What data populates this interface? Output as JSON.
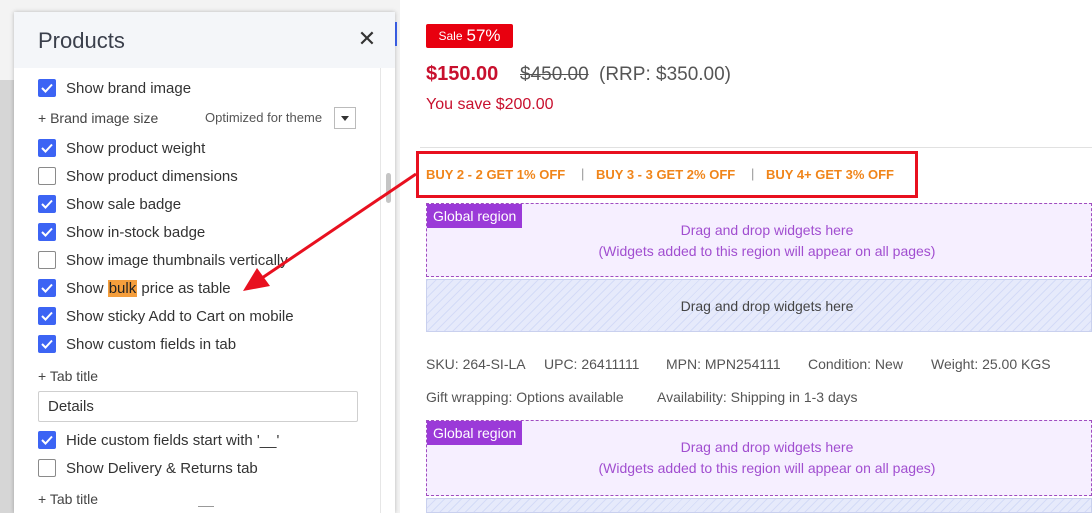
{
  "panel": {
    "title": "Products",
    "close_icon": "close-icon",
    "items": [
      {
        "label": "Show brand image",
        "checked": true
      },
      {
        "label": "Show product weight",
        "checked": true
      },
      {
        "label": "Show product dimensions",
        "checked": false
      },
      {
        "label": "Show sale badge",
        "checked": true
      },
      {
        "label": "Show in-stock badge",
        "checked": true
      },
      {
        "label": "Show image thumbnails vertically",
        "checked": false
      },
      {
        "label_pre": "Show ",
        "label_hl": "bulk",
        "label_post": " price as table",
        "checked": true
      },
      {
        "label": "Show sticky Add to Cart on mobile",
        "checked": true
      },
      {
        "label": "Show custom fields in tab",
        "checked": true
      },
      {
        "label": "Hide custom fields start with '__'",
        "checked": true
      },
      {
        "label": "Show Delivery & Returns tab",
        "checked": false
      }
    ],
    "brand_image_size": {
      "label": "+ Brand image size",
      "value": "Optimized for theme"
    },
    "tab_title": {
      "label": "+ Tab title",
      "value": "Details"
    },
    "tab_title_2": {
      "label": "+ Tab title"
    }
  },
  "product": {
    "sale_label": "Sale",
    "sale_percent": "57%",
    "price": "$150.00",
    "old_price": "$450.00",
    "rrp": "(RRP: $350.00)",
    "you_save": "You save $200.00",
    "bulk": [
      {
        "pre": "BUY 2 - 2 GET ",
        "pct": "1%",
        "post": " OFF"
      },
      {
        "pre": "BUY 3 - 3 GET ",
        "pct": "2%",
        "post": " OFF"
      },
      {
        "pre": "BUY 4+ GET ",
        "pct": "3%",
        "post": " OFF"
      }
    ],
    "bulk_separator": "|",
    "region_label": "Global region",
    "drop_text": "Drag and drop widgets here",
    "drop_note": "(Widgets added to this region will appear on all pages)",
    "meta": {
      "sku": "SKU: 264-SI-LA",
      "upc": "UPC: 26411111",
      "mpn": "MPN: MPN254111",
      "condition": "Condition: New",
      "weight": "Weight: 25.00 KGS",
      "gift": "Gift wrapping: Options available",
      "availability": "Availability: Shipping in 1-3 days"
    }
  },
  "colors": {
    "accent": "#3c64f4",
    "sale": "#e8000f",
    "price": "#c8102e",
    "bulk": "#f0851a",
    "annotation": "#e8101f",
    "region": "#9b3ad8"
  }
}
